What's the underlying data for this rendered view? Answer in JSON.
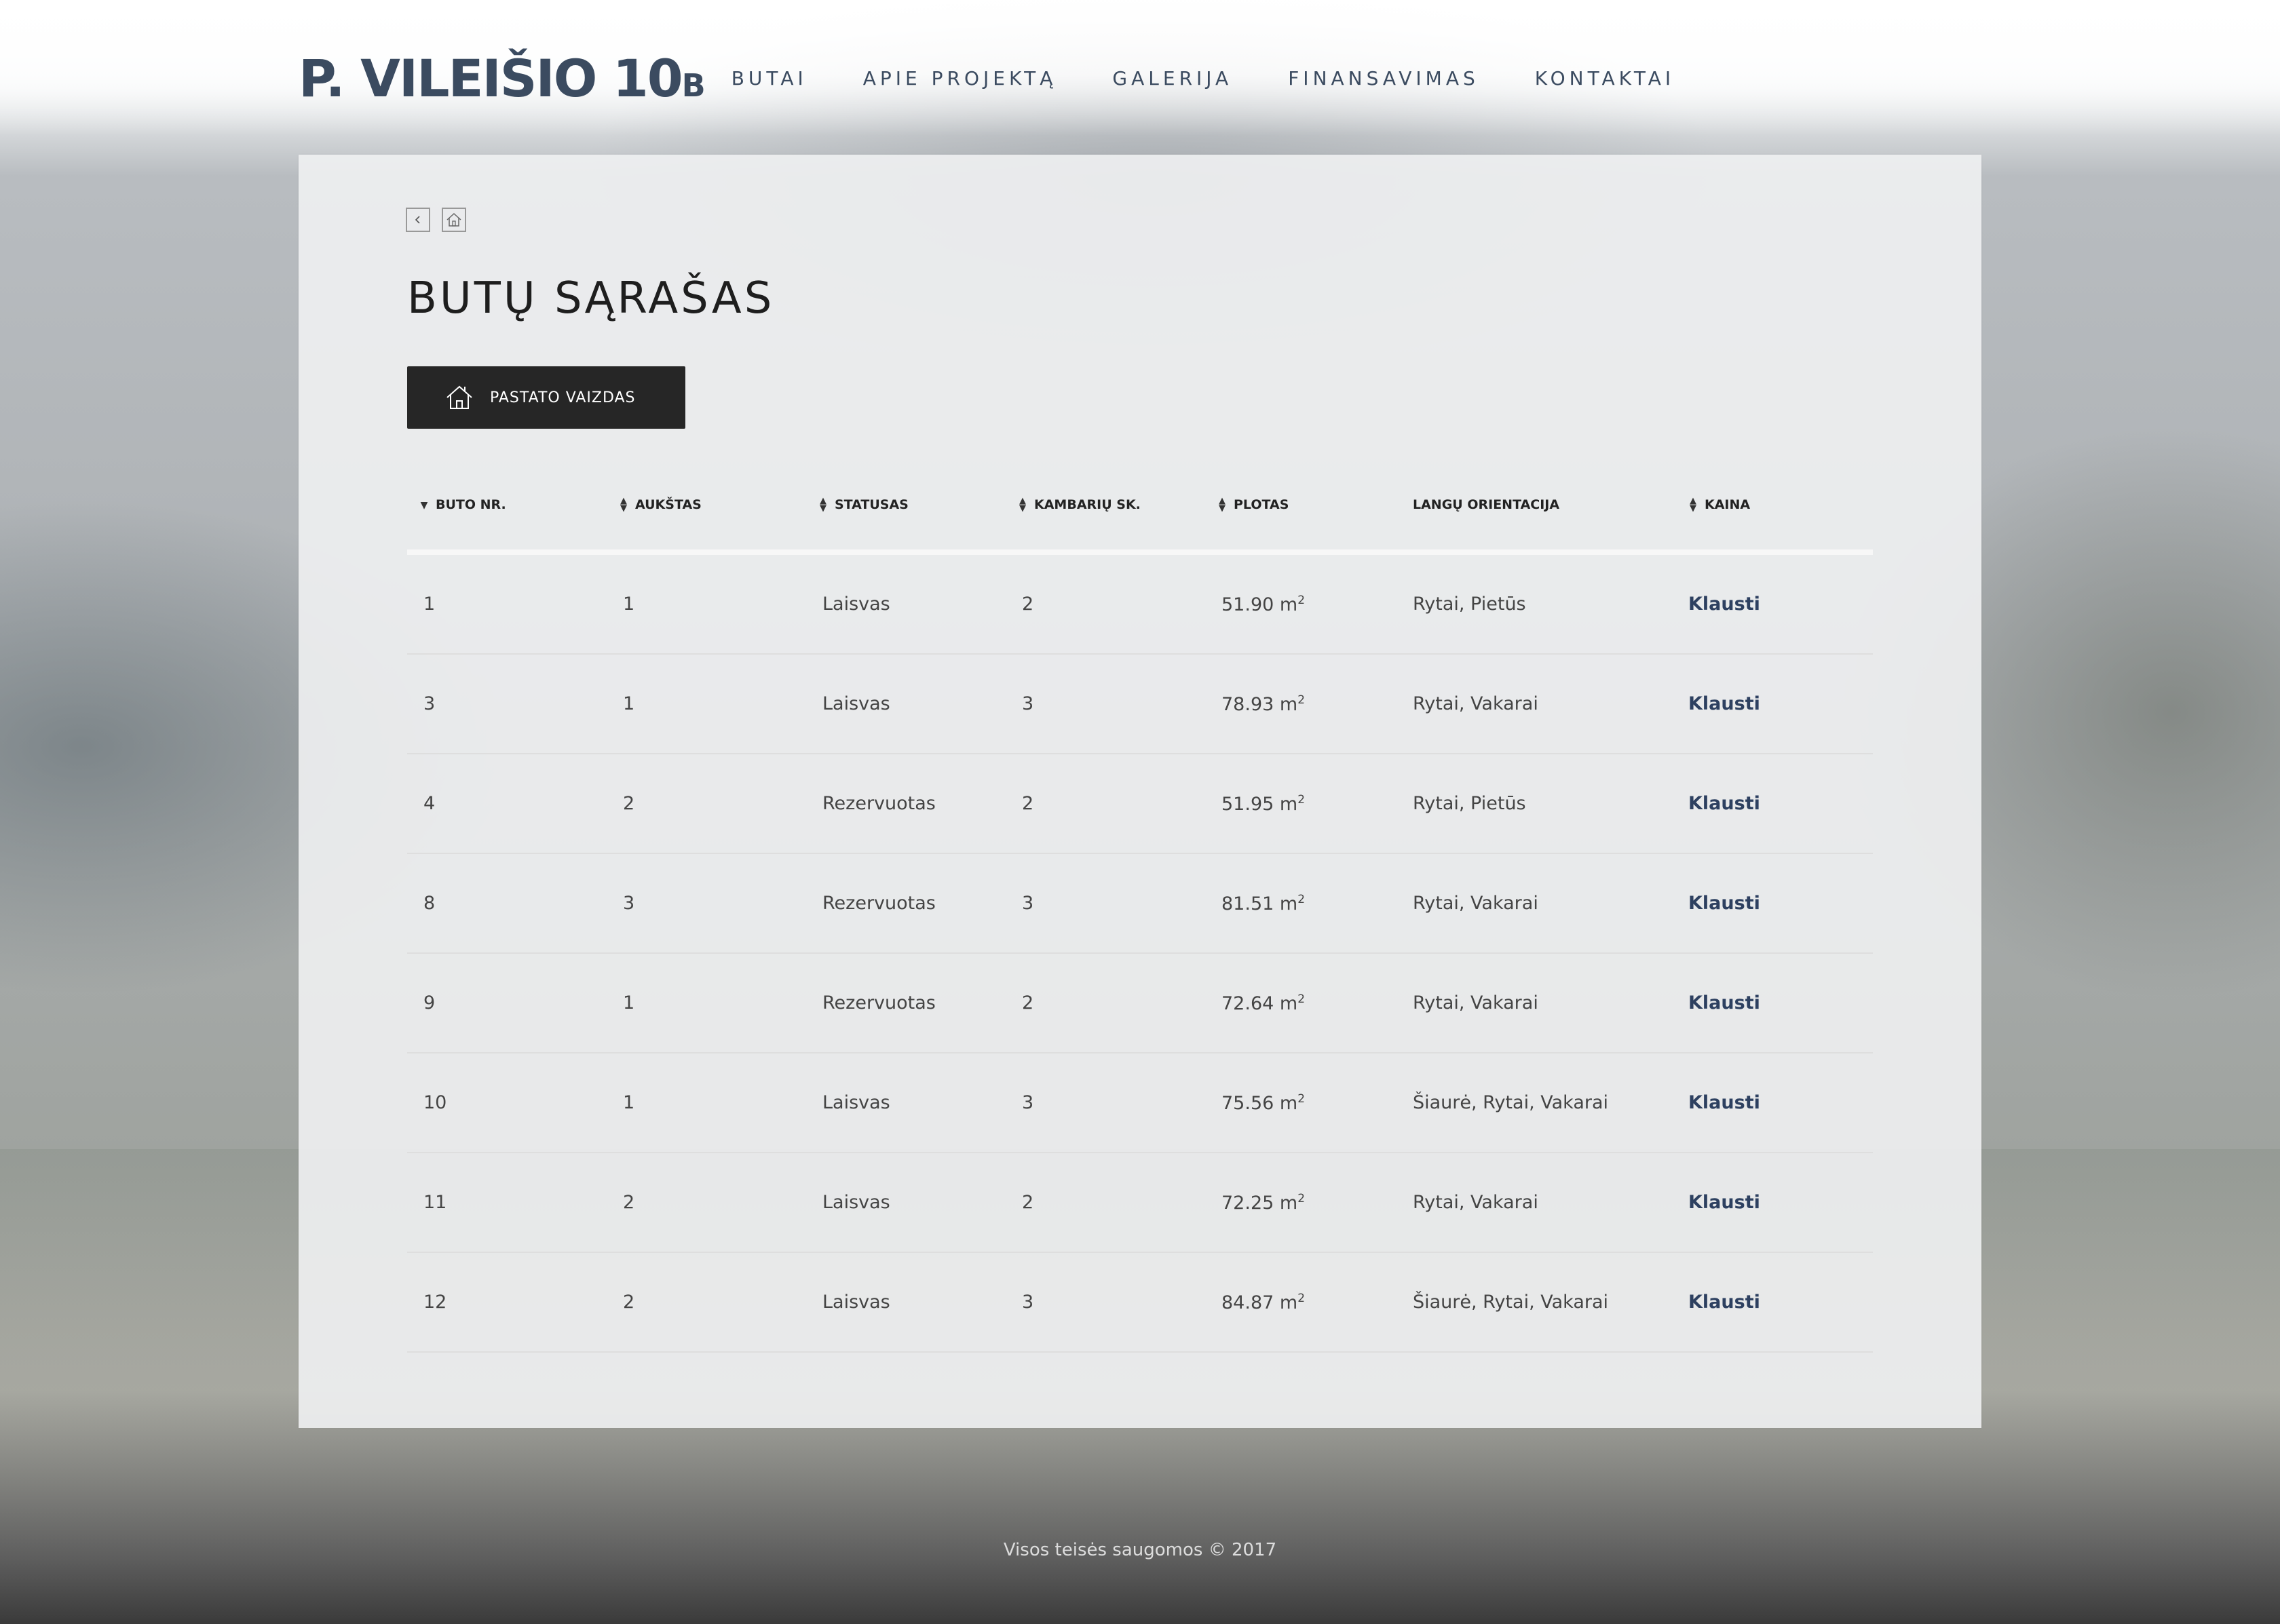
{
  "logo": {
    "main": "P. VILEIŠIO 10",
    "suffix": "B"
  },
  "nav": [
    {
      "label": "BUTAI"
    },
    {
      "label": "APIE PROJEKTĄ"
    },
    {
      "label": "GALERIJA"
    },
    {
      "label": "FINANSAVIMAS"
    },
    {
      "label": "KONTAKTAI"
    }
  ],
  "breadcrumbs": {
    "back_icon": "chevron-left-icon",
    "home_icon": "home-icon"
  },
  "page_title": "BUTŲ SĄRAŠAS",
  "building_button": {
    "label": "PASTATO VAIZDAS",
    "icon": "house-icon"
  },
  "table": {
    "headers": [
      {
        "label": "BUTO NR.",
        "sort": "desc"
      },
      {
        "label": "AUKŠTAS",
        "sort": "both"
      },
      {
        "label": "STATUSAS",
        "sort": "both"
      },
      {
        "label": "KAMBARIŲ SK.",
        "sort": "both"
      },
      {
        "label": "PLOTAS",
        "sort": "both"
      },
      {
        "label": "LANGŲ ORIENTACIJA",
        "sort": "none"
      },
      {
        "label": "KAINA",
        "sort": "both"
      }
    ],
    "area_unit": "m",
    "area_unit_exp": "2",
    "rows": [
      {
        "nr": "1",
        "floor": "1",
        "status": "Laisvas",
        "rooms": "2",
        "area": "51.90",
        "orientation": "Rytai, Pietūs",
        "price": "Klausti"
      },
      {
        "nr": "3",
        "floor": "1",
        "status": "Laisvas",
        "rooms": "3",
        "area": "78.93",
        "orientation": "Rytai, Vakarai",
        "price": "Klausti"
      },
      {
        "nr": "4",
        "floor": "2",
        "status": "Rezervuotas",
        "rooms": "2",
        "area": "51.95",
        "orientation": "Rytai, Pietūs",
        "price": "Klausti"
      },
      {
        "nr": "8",
        "floor": "3",
        "status": "Rezervuotas",
        "rooms": "3",
        "area": "81.51",
        "orientation": "Rytai, Vakarai",
        "price": "Klausti"
      },
      {
        "nr": "9",
        "floor": "1",
        "status": "Rezervuotas",
        "rooms": "2",
        "area": "72.64",
        "orientation": "Rytai, Vakarai",
        "price": "Klausti"
      },
      {
        "nr": "10",
        "floor": "1",
        "status": "Laisvas",
        "rooms": "3",
        "area": "75.56",
        "orientation": "Šiaurė, Rytai, Vakarai",
        "price": "Klausti"
      },
      {
        "nr": "11",
        "floor": "2",
        "status": "Laisvas",
        "rooms": "2",
        "area": "72.25",
        "orientation": "Rytai, Vakarai",
        "price": "Klausti"
      },
      {
        "nr": "12",
        "floor": "2",
        "status": "Laisvas",
        "rooms": "3",
        "area": "84.87",
        "orientation": "Šiaurė, Rytai, Vakarai",
        "price": "Klausti"
      }
    ]
  },
  "footer": {
    "text": "Visos teisės saugomos © 2017"
  },
  "colors": {
    "brand": "#3b4b60",
    "button_bg": "#262626",
    "link": "#2d4060"
  }
}
